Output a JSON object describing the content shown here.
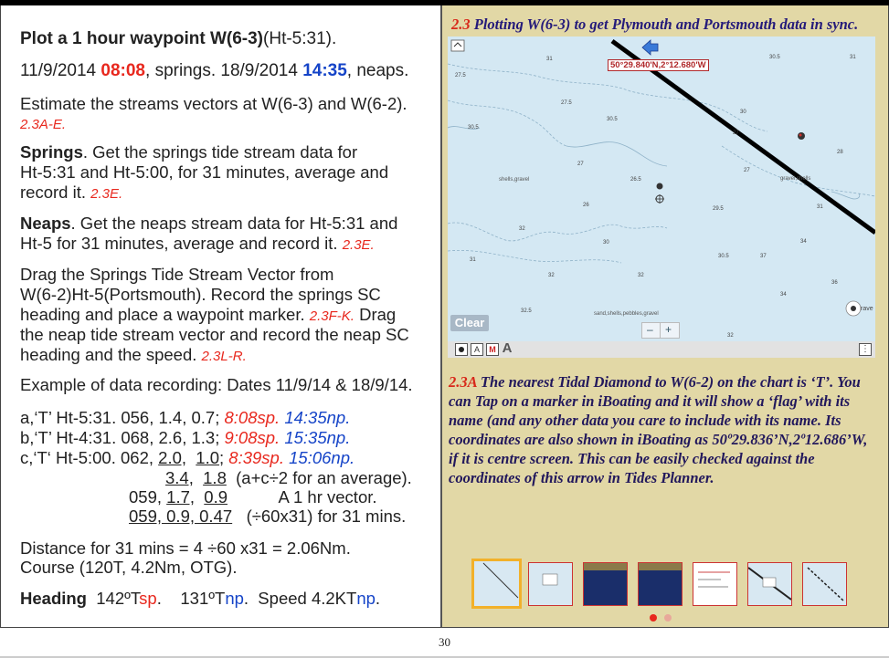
{
  "left": {
    "title_bold": "Plot a 1 hour waypoint W(6-3)",
    "title_rest": "(Ht-5:31).",
    "dates": {
      "d1": "11/9/2014 ",
      "t1": "08:08",
      "mid": ", springs. 18/9/2014 ",
      "t2": "14:35",
      "end": ", neaps."
    },
    "estimate": {
      "line1": "Estimate the streams vectors at W(6-3) and W(6-2).",
      "ref": "2.3A-E."
    },
    "springs": {
      "head": "Springs",
      "l1": ". Get the springs tide stream data for",
      "l2": "Ht-5:31 and Ht-5:00, for 31 minutes, average and",
      "l3": "record it. ",
      "ref": "2.3E."
    },
    "neaps": {
      "head": "Neaps",
      "l1": ". Get the neaps stream data for Ht-5:31 and",
      "l2": "Ht-5 for 31 minutes, average and record it. ",
      "ref": "2.3E."
    },
    "drag": {
      "l1": "Drag the Springs Tide Stream Vector from",
      "l2": "W(6-2)Ht-5(Portsmouth). Record the springs SC",
      "l3": "heading and place a waypoint marker. ",
      "ref1": "2.3F-K.",
      "l3b": " Drag",
      "l4": "the neap tide stream vector and record the neap SC",
      "l5": "heading and the speed. ",
      "ref2": "2.3L-R."
    },
    "example": "Example of data recording: Dates 11/9/14 & 18/9/14.",
    "rows": [
      {
        "text": "a,‘T’  Ht-5:31. 056, 1.4,   0.7; ",
        "sp": "8:08sp.",
        "np": "14:35np."
      },
      {
        "text": "b,‘T’  Ht-4:31. 068, 2.6,   1.3; ",
        "sp": "9:08sp.",
        "np": "15:35np."
      },
      {
        "text_pre": "c,‘T‘  Ht-5:00. 062, ",
        "u1": "2.0,",
        "mid": "  ",
        "u2": "1.0",
        "post": "; ",
        "sp": "8:39sp.",
        "np": "15:06np."
      }
    ],
    "avg": {
      "u1": "3.4,",
      "sp": "  ",
      "u2": "1.8",
      "rest": "  (a+c÷2 for an average)."
    },
    "hr": {
      "pre": "059, ",
      "u1": "1.7,",
      "sp": "  ",
      "u2": "0.9",
      "rest": "           A 1 hr vector."
    },
    "m31": {
      "u": "059, 0.9, 0.47",
      "rest": "   (÷60x31) for 31 mins."
    },
    "distance": "Distance for 31 mins = 4 ÷60 x31 = 2.06Nm.",
    "course": "Course  (120T, 4.2Nm, OTG).",
    "heading": {
      "head": "Heading",
      "v1": "  142ºT",
      "sp": "sp",
      "v2": ".    131ºT",
      "np1": "np",
      "v3": ".  Speed 4.2KT",
      "np2": "np",
      "end": "."
    }
  },
  "right": {
    "title_num": "2.3",
    "title_text": " Plotting W(6-3) to get Plymouth and Portsmouth data in sync.",
    "chart": {
      "coord_flag": "50°29.840'N,2°12.680'W",
      "clear_label": "Clear",
      "zoom_minus": "–",
      "zoom_plus": "+",
      "tool_a": "A",
      "tool_m": "M",
      "tool_big_a": "A",
      "sand_label": "sand,shells,pebbles,gravel",
      "shells_label": "shells,gravel",
      "gravel_label": "gravel,shells",
      "rave": "rave",
      "sounding_labels": [
        "31",
        "30.5",
        "31",
        "27.5",
        "30.5",
        "30",
        "30.5",
        "27",
        "27",
        "26.5",
        "27",
        "28",
        "26",
        "29.5",
        "32",
        "31",
        "30",
        "34",
        "32",
        "30.5",
        "31",
        "37",
        "34",
        "36",
        "32",
        "32.5",
        "27.5",
        "32"
      ]
    },
    "caption": {
      "num": "2.3A",
      "text": " The nearest Tidal Diamond to W(6-2) on the chart is ‘T’. You can Tap on a marker in iBoating and it will show a ‘flag’ with its name (and any other data you care to include with its name. Its coordinates are also shown in iBoating as 50º29.836’N,2º12.686’W, if it is centre screen.  This can be easily checked against the coordinates of this arrow in Tides Planner."
    }
  },
  "page_number": "30",
  "colors": {
    "red": "#e8281e",
    "blue": "#1544c8",
    "panel": "#e2d8a6",
    "chart_sea": "#d4e8f3",
    "caption": "#22185c"
  }
}
